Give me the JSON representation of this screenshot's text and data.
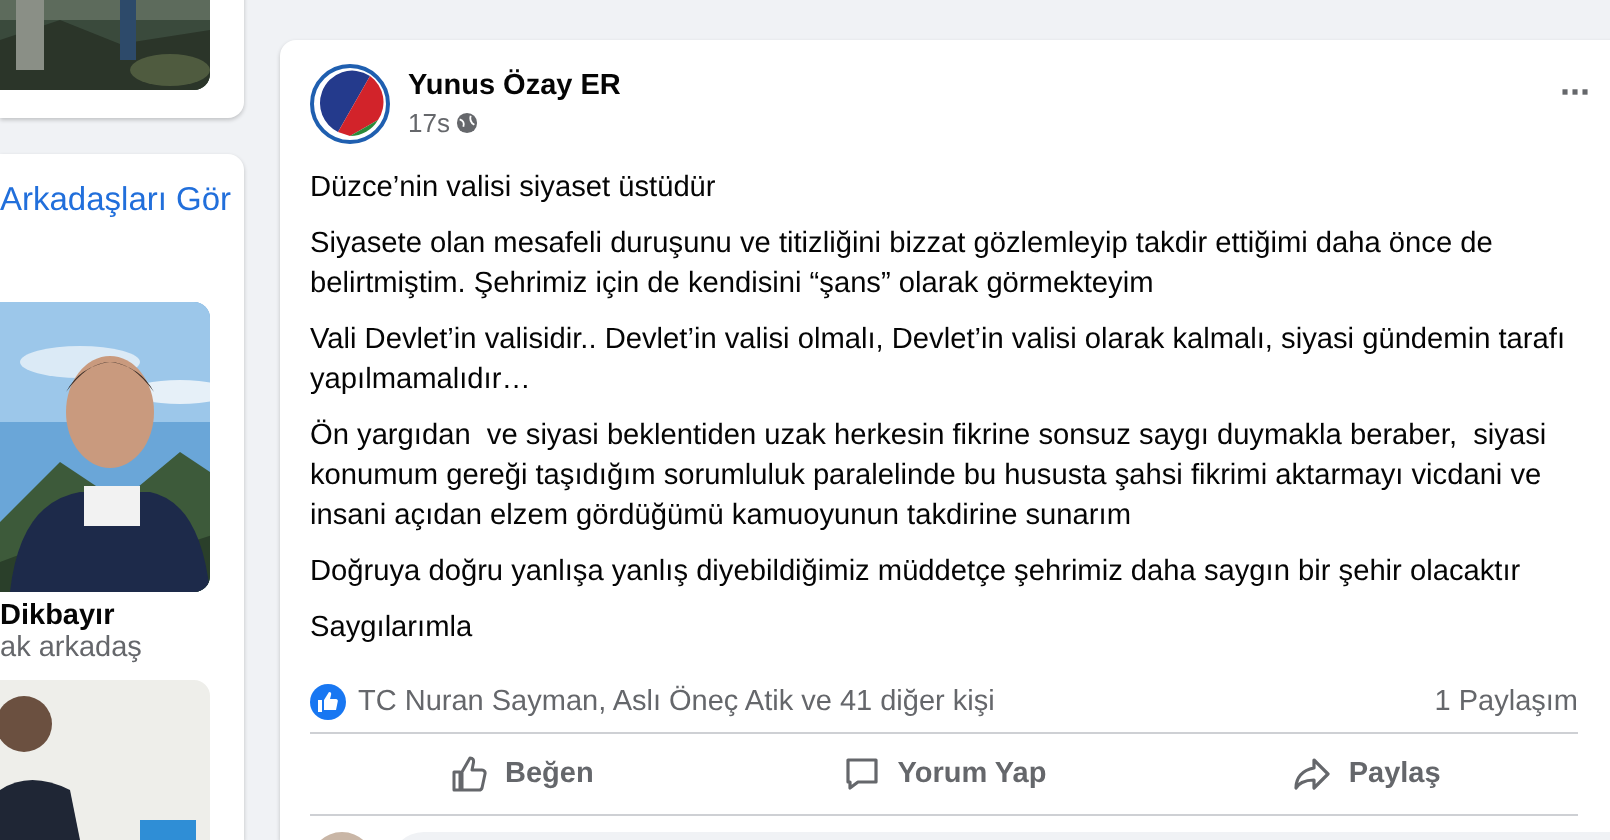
{
  "sidebar": {
    "top_card": {
      "kind": "picture"
    },
    "friends_card": {
      "link": "Arkadaşları Gör",
      "suggestions": [
        {
          "name": "Dikbayır",
          "detail": "ak arkadaş"
        },
        {
          "kind": "picture"
        }
      ]
    }
  },
  "post": {
    "author": "Yunus Özay ER",
    "time": "17s",
    "more": "···",
    "paragraphs": [
      "Düzce’nin valisi siyaset üstüdür",
      "Siyasete olan mesafeli duruşunu ve titizliğini bizzat gözlemleyip takdir ettiğimi daha önce de belirtmiştim. Şehrimiz için de kendisini “şans” olarak görmekteyim",
      "Vali Devlet’in valisidir.. Devlet’in valisi olmalı, Devlet’in valisi olarak kalmalı, siyasi gündemin tarafı yapılmamalıdır…",
      "Ön yargıdan  ve siyasi beklentiden uzak herkesin fikrine sonsuz saygı duymakla beraber,  siyasi konumum gereği taşıdığım sorumluluk paralelinde bu hususta şahsi fikrimi aktarmayı vicdani ve insani açıdan elzem gördüğümü kamuoyunun takdirine sunarım",
      "Doğruya doğru yanlışa yanlış diyebildiğimiz müddetçe şehrimiz daha saygın bir şehir olacaktır",
      "Saygılarımla"
    ],
    "reactions": "TC Nuran Sayman, Aslı Öneç Atik ve 41 diğer kişi",
    "shares": "1 Paylaşım",
    "actions": [
      {
        "kind": "like",
        "label": "Beğen"
      },
      {
        "kind": "comment",
        "label": "Yorum Yap"
      },
      {
        "kind": "share",
        "label": "Paylaş"
      }
    ]
  }
}
